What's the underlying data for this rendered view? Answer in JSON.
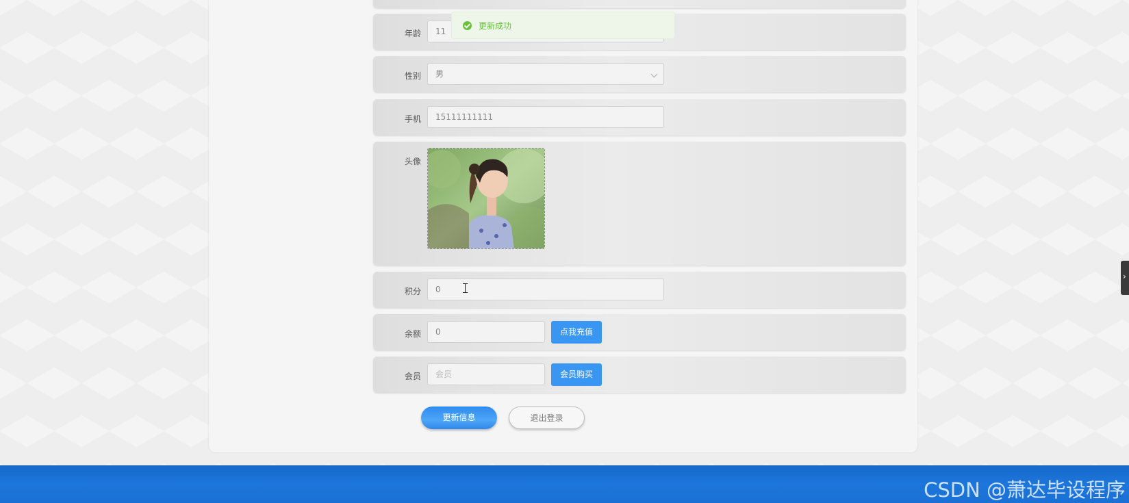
{
  "toast": {
    "message": "更新成功",
    "type": "success",
    "color": "#67c23a"
  },
  "form": {
    "age": {
      "label": "年龄",
      "value": "11"
    },
    "gender": {
      "label": "性别",
      "value": "男"
    },
    "phone": {
      "label": "手机",
      "value": "15111111111"
    },
    "avatar": {
      "label": "头像",
      "image_desc": "girl-with-ponytail-photo"
    },
    "points": {
      "label": "积分",
      "value": "0"
    },
    "balance": {
      "label": "余额",
      "value": "0",
      "action_label": "点我充值"
    },
    "membership": {
      "label": "会员",
      "placeholder": "会员",
      "action_label": "会员购买"
    }
  },
  "actions": {
    "update_label": "更新信息",
    "logout_label": "退出登录"
  },
  "watermark": "CSDN @萧达毕设程序",
  "colors": {
    "primary": "#3a96f3",
    "taskbar": "#1d76db"
  }
}
